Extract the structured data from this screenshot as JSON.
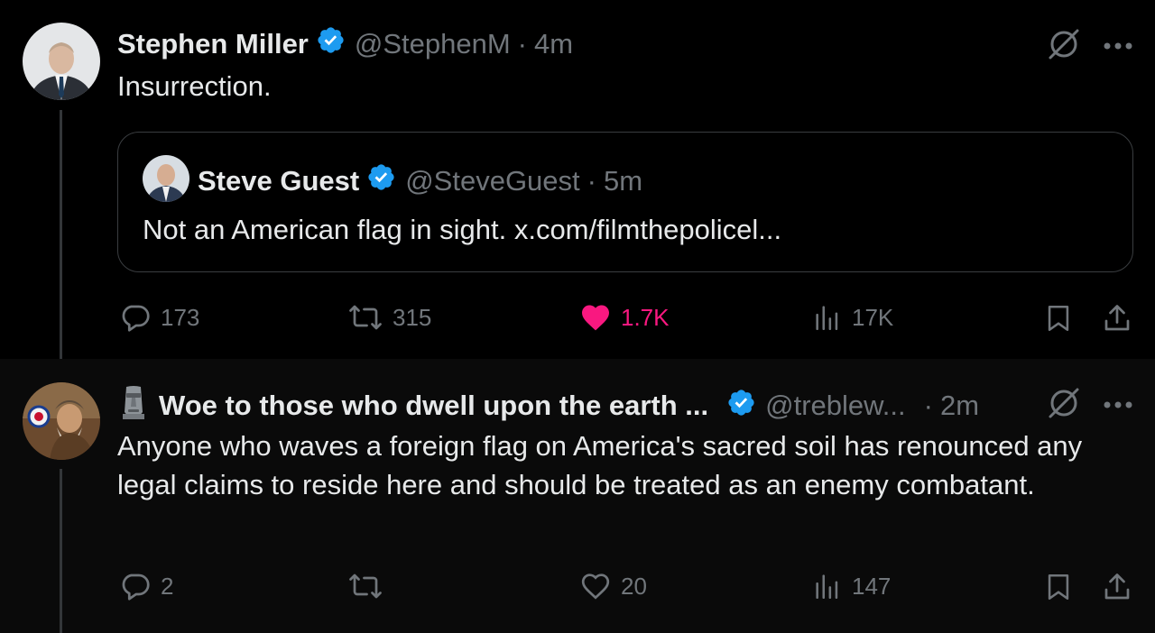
{
  "post1": {
    "author_name": "Stephen Miller",
    "author_handle": "@StephenM",
    "separator": "·",
    "time": "4m",
    "text": "Insurrection.",
    "quote": {
      "author_name": "Steve Guest",
      "author_handle": "@SteveGuest",
      "separator": "·",
      "time": "5m",
      "text": "Not an American flag in sight. x.com/filmthepolicel..."
    },
    "replies": "173",
    "reposts": "315",
    "likes": "1.7K",
    "views": "17K"
  },
  "post2": {
    "emoji": "🗿",
    "author_name": "Woe to those who dwell upon the earth ...",
    "author_handle": "@treblew...",
    "separator": "·",
    "time": "2m",
    "text": "Anyone who waves a foreign flag on America's sacred soil has renounced any legal claims to reside here and should be treated as an enemy combatant.",
    "replies": "2",
    "reposts": "",
    "likes": "20",
    "views": "147"
  },
  "colors": {
    "background": "#000000",
    "reply_background": "#0a0a0a",
    "text": "#e7e9ea",
    "secondary": "#71767b",
    "verified": "#1d9bf0",
    "like": "#f91880",
    "border": "#3a3d40"
  },
  "icons": [
    "verified-badge-icon",
    "grok-icon",
    "more-icon",
    "reply-icon",
    "repost-icon",
    "like-icon",
    "views-icon",
    "bookmark-icon",
    "share-icon",
    "moai-emoji"
  ]
}
